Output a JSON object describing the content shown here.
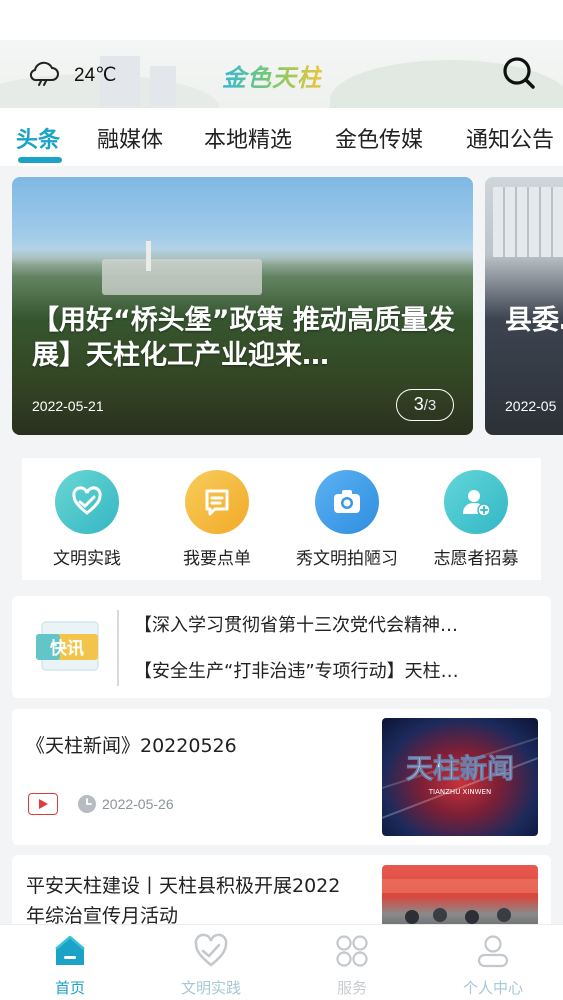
{
  "header": {
    "weather_icon": "cloud-icon",
    "temperature": "24℃",
    "logo_text": "金色天柱",
    "search_icon": "search-icon"
  },
  "tabs": [
    {
      "label": "头条",
      "active": true
    },
    {
      "label": "融媒体"
    },
    {
      "label": "本地精选"
    },
    {
      "label": "金色传媒"
    },
    {
      "label": "通知公告"
    }
  ],
  "carousel": {
    "current": {
      "title": "【用好“桥头堡”政策 推动高质量发展】天柱化工产业迎来…",
      "date": "2022-05-21",
      "page_current": "3",
      "page_separator": "/",
      "page_total": "3"
    },
    "next": {
      "title": "县委…商考…",
      "date": "2022-05"
    }
  },
  "quick_actions": [
    {
      "label": "文明实践",
      "icon": "heart-hands-icon",
      "color": "#4cc3c9"
    },
    {
      "label": "我要点单",
      "icon": "order-note-icon",
      "color": "#f4b63a"
    },
    {
      "label": "秀文明拍陋习",
      "icon": "camera-icon",
      "color": "#3f9de8"
    },
    {
      "label": "志愿者招募",
      "icon": "volunteer-add-icon",
      "color": "#3fc6cf"
    }
  ],
  "flash_news": {
    "badge_text": "快讯",
    "items": [
      "【深入学习贯彻省第十三次党代会精神…",
      "【安全生产“打非治违”专项行动】天柱…"
    ]
  },
  "news": [
    {
      "title": "《天柱新闻》20220526",
      "date": "2022-05-26",
      "thumb_text": "天柱新闻",
      "thumb_sub": "TIANZHU XINWEN",
      "has_video": true
    },
    {
      "title": "平安天柱建设丨天柱县积极开展2022年综治宣传月活动"
    }
  ],
  "bottom_nav": [
    {
      "label": "首页",
      "icon": "home-icon",
      "active": true
    },
    {
      "label": "文明实践",
      "icon": "heart-hands-icon"
    },
    {
      "label": "服务",
      "icon": "grid-icon"
    },
    {
      "label": "个人中心",
      "icon": "user-icon"
    }
  ],
  "colors": {
    "accent": "#1aa3c6",
    "video_red": "#e23a3a"
  }
}
